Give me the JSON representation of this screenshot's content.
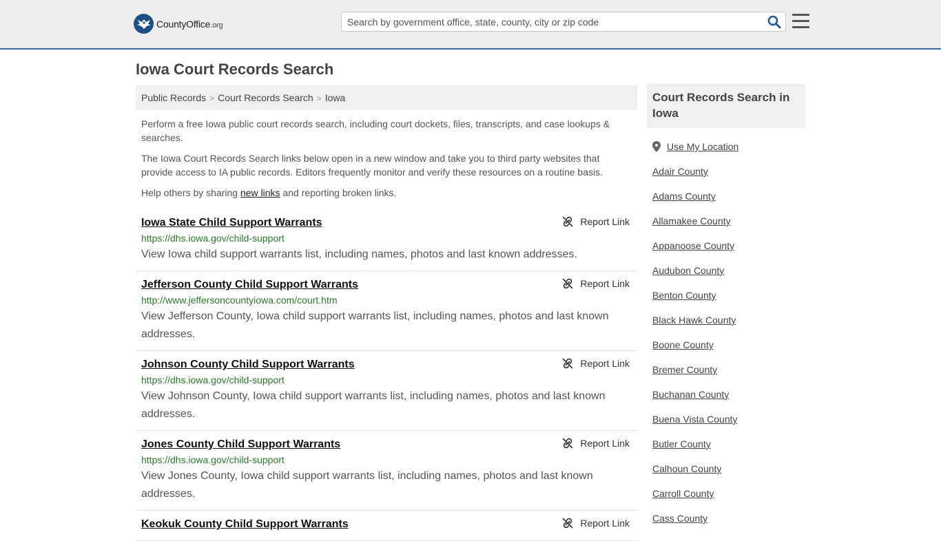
{
  "header": {
    "logo_main": "CountyOffice",
    "logo_suffix": ".org",
    "search_placeholder": "Search by government office, state, county, city or zip code"
  },
  "page": {
    "title": "Iowa Court Records Search"
  },
  "breadcrumb": [
    "Public Records",
    "Court Records Search",
    "Iowa"
  ],
  "intro": {
    "p1": "Perform a free Iowa public court records search, including court dockets, files, transcripts, and case lookups & searches.",
    "p2": "The Iowa Court Records Search links below open in a new window and take you to third party websites that provide access to IA public records. Editors frequently monitor and verify these resources on a routine basis.",
    "p3_before": "Help others by sharing ",
    "p3_link": "new links",
    "p3_after": " and reporting broken links."
  },
  "results": [
    {
      "title": "Iowa State Child Support Warrants",
      "url": "https://dhs.iowa.gov/child-support",
      "desc": "View Iowa child support warrants list, including names, photos and last known addresses.",
      "report": "Report Link"
    },
    {
      "title": "Jefferson County Child Support Warrants",
      "url": "http://www.jeffersoncountyiowa.com/court.htm",
      "desc": "View Jefferson County, Iowa child support warrants list, including names, photos and last known addresses.",
      "report": "Report Link"
    },
    {
      "title": "Johnson County Child Support Warrants",
      "url": "https://dhs.iowa.gov/child-support",
      "desc": "View Johnson County, Iowa child support warrants list, including names, photos and last known addresses.",
      "report": "Report Link"
    },
    {
      "title": "Jones County Child Support Warrants",
      "url": "https://dhs.iowa.gov/child-support",
      "desc": "View Jones County, Iowa child support warrants list, including names, photos and last known addresses.",
      "report": "Report Link"
    },
    {
      "title": "Keokuk County Child Support Warrants",
      "url": "",
      "desc": "",
      "report": "Report Link"
    }
  ],
  "sidebar": {
    "title": "Court Records Search in Iowa",
    "location_label": "Use My Location",
    "counties": [
      "Adair County",
      "Adams County",
      "Allamakee County",
      "Appanoose County",
      "Audubon County",
      "Benton County",
      "Black Hawk County",
      "Boone County",
      "Bremer County",
      "Buchanan County",
      "Buena Vista County",
      "Butler County",
      "Calhoun County",
      "Carroll County",
      "Cass County"
    ]
  },
  "colors": {
    "header_bg": "#eeeeef",
    "header_border": "#3d6a9c",
    "logo_blue": "#1f4e83",
    "url_green": "#2b7a2b"
  }
}
